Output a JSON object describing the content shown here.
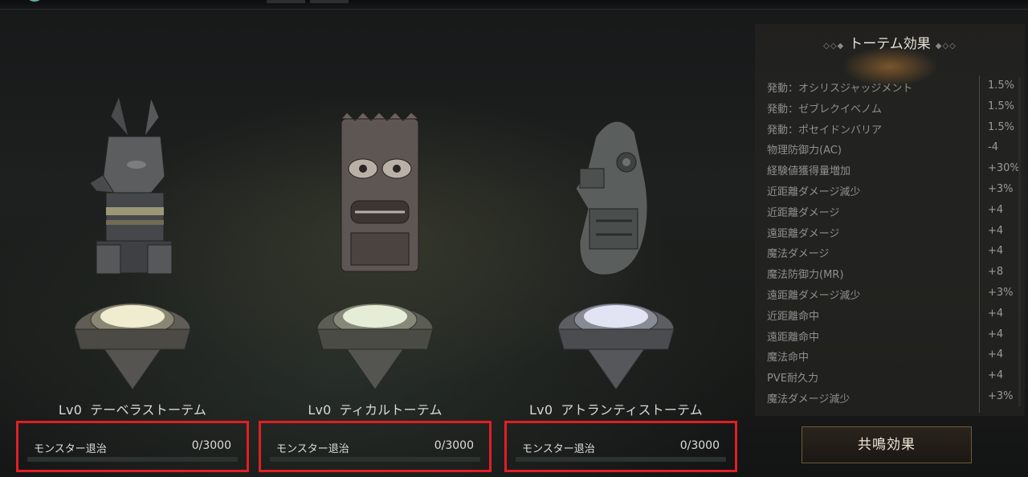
{
  "colors": {
    "highlight": "#e21e25",
    "gold": "#6f5a3c",
    "progress_fill": "#8fb14a"
  },
  "totems": [
    {
      "level": "Lv0",
      "name": "テーベラストーテム",
      "quest_label": "モンスター退治",
      "quest_count": "0/3000",
      "progress": 0,
      "figure": "anubis-statue",
      "platform_glow": "#f0ecd0"
    },
    {
      "level": "Lv0",
      "name": "ティカルトーテム",
      "quest_label": "モンスター退治",
      "quest_count": "0/3000",
      "progress": 0,
      "figure": "tiki-mask",
      "platform_glow": "#e6edd6"
    },
    {
      "level": "Lv0",
      "name": "アトランティストーテム",
      "quest_label": "モンスター退治",
      "quest_count": "0/3000",
      "progress": 0,
      "figure": "sea-creature-statue",
      "platform_glow": "#e2e4f4"
    }
  ],
  "effects_panel": {
    "title": "トーテム効果",
    "rows": [
      {
        "name": "発動：オシリスジャッジメント",
        "value": "1.5%"
      },
      {
        "name": "発動：ゼブレクイベノム",
        "value": "1.5%"
      },
      {
        "name": "発動：ポセイドンバリア",
        "value": "1.5%"
      },
      {
        "name": "物理防御力(AC)",
        "value": "-4"
      },
      {
        "name": "経験値獲得量増加",
        "value": "+30%"
      },
      {
        "name": "近距離ダメージ減少",
        "value": "+3%"
      },
      {
        "name": "近距離ダメージ",
        "value": "+4"
      },
      {
        "name": "遠距離ダメージ",
        "value": "+4"
      },
      {
        "name": "魔法ダメージ",
        "value": "+4"
      },
      {
        "name": "魔法防御力(MR)",
        "value": "+8"
      },
      {
        "name": "遠距離ダメージ減少",
        "value": "+3%"
      },
      {
        "name": "近距離命中",
        "value": "+4"
      },
      {
        "name": "遠距離命中",
        "value": "+4"
      },
      {
        "name": "魔法命中",
        "value": "+4"
      },
      {
        "name": "PVE耐久力",
        "value": "+4"
      },
      {
        "name": "魔法ダメージ減少",
        "value": "+3%"
      }
    ]
  },
  "resonance_button": {
    "label": "共鳴効果"
  }
}
